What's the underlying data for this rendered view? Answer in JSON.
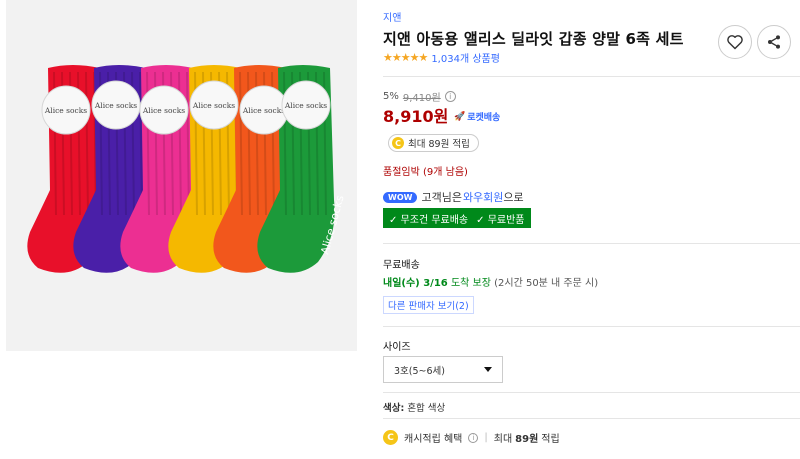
{
  "product": {
    "brand": "지앤",
    "title": "지앤 아동용 앨리스 딜라잇 갑종 양말 6족 세트",
    "stars": "★★★★★",
    "review_count": "1,034개 상품평",
    "rating_fraction": 1.0
  },
  "image": {
    "tag_text": "Alice socks",
    "sock_side_text": "Alice socks",
    "sock_colors": [
      "#e8102a",
      "#4a1fa8",
      "#ec2f92",
      "#f5b800",
      "#f2571c",
      "#1c9a3a"
    ]
  },
  "pricing": {
    "discount_rate": "5%",
    "original_price": "9,410원",
    "info_icon": "i",
    "sale_price": "8,910원",
    "rocket_label": "로켓배송",
    "rocket_icon": "🚀"
  },
  "cash": {
    "coin_symbol": "C",
    "pill_text": "최대 89원 적립"
  },
  "stock": {
    "urgency": "품절임박 (9개 남음)"
  },
  "wow": {
    "badge": "WOW",
    "text_before": "고객님은",
    "link": "와우회원",
    "text_after": "으로",
    "benefit_1": "✓ 무조건 무료배송",
    "benefit_2": "✓ 무료반품"
  },
  "delivery": {
    "title": "무료배송",
    "date_bold": "내일(수) 3/16",
    "guarantee": "도착 보장",
    "note": "(2시간 50분 내 주문 시)",
    "other_sellers": "다른 판매자 보기(2)"
  },
  "options": {
    "size_label": "사이즈",
    "size_value": "3호(5~6세)",
    "color_label": "색상:",
    "color_value": "혼합 색상"
  },
  "cash_benefit": {
    "label": "캐시적립 혜택",
    "info_icon": "i",
    "separator": "|",
    "max_text": "최대",
    "amount": "89원",
    "suffix": "적립"
  }
}
